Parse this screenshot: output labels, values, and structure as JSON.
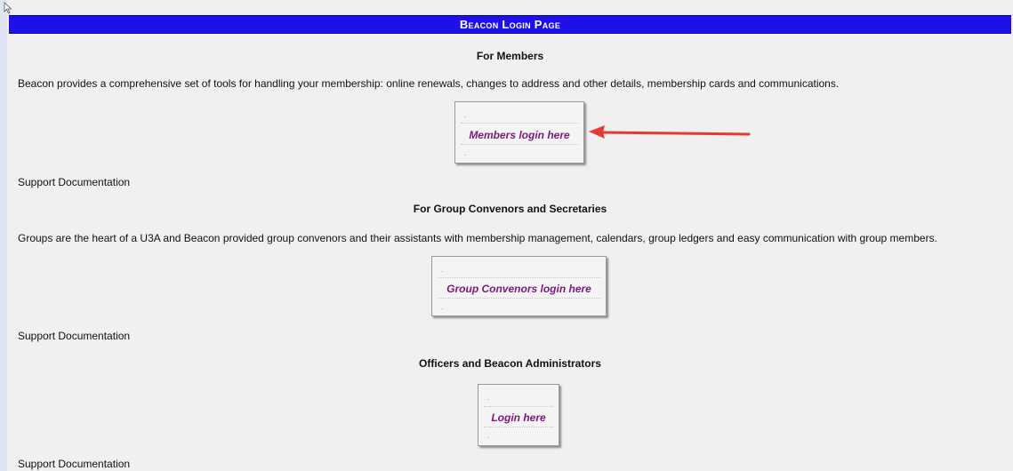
{
  "page_title": "Beacon Login Page",
  "sections": [
    {
      "heading": "For Members",
      "description": "Beacon provides a comprehensive set of tools for handling your membership: online renewals, changes to address and other details, membership cards and communications.",
      "login_label": "Members login here",
      "support_label": "Support Documentation"
    },
    {
      "heading": "For Group Convenors and Secretaries",
      "description": "Groups are the heart of a U3A and Beacon provided group convenors and their assistants with membership management, calendars, group ledgers and easy communication with group members.",
      "login_label": "Group Convenors login here",
      "support_label": "Support Documentation"
    },
    {
      "heading": "Officers and Beacon Administrators",
      "login_label": "Login here",
      "support_label": "Support Documentation"
    }
  ],
  "box_dot": ".",
  "colors": {
    "title_bar": "#1f0fe8",
    "login_text": "#7a1a7a",
    "annotation_arrow": "#e53935"
  },
  "icons": {
    "cursor": "mouse-pointer-icon",
    "annotation": "red-arrow-icon"
  }
}
